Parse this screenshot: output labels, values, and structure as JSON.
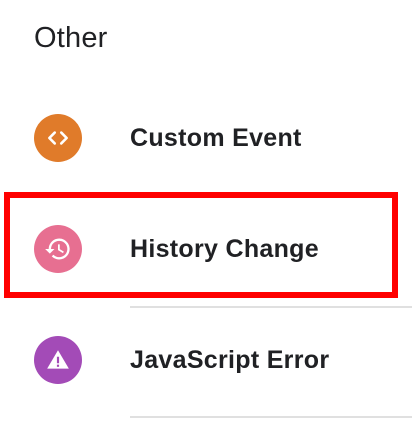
{
  "section": {
    "title": "Other"
  },
  "items": [
    {
      "label": "Custom Event",
      "icon": "code-icon",
      "color": "#e07b2a"
    },
    {
      "label": "History Change",
      "icon": "history-icon",
      "color": "#e76f91"
    },
    {
      "label": "JavaScript Error",
      "icon": "warning-icon",
      "color": "#a34bb7"
    }
  ],
  "highlight": {
    "color": "#ff0000",
    "target": "History Change"
  }
}
